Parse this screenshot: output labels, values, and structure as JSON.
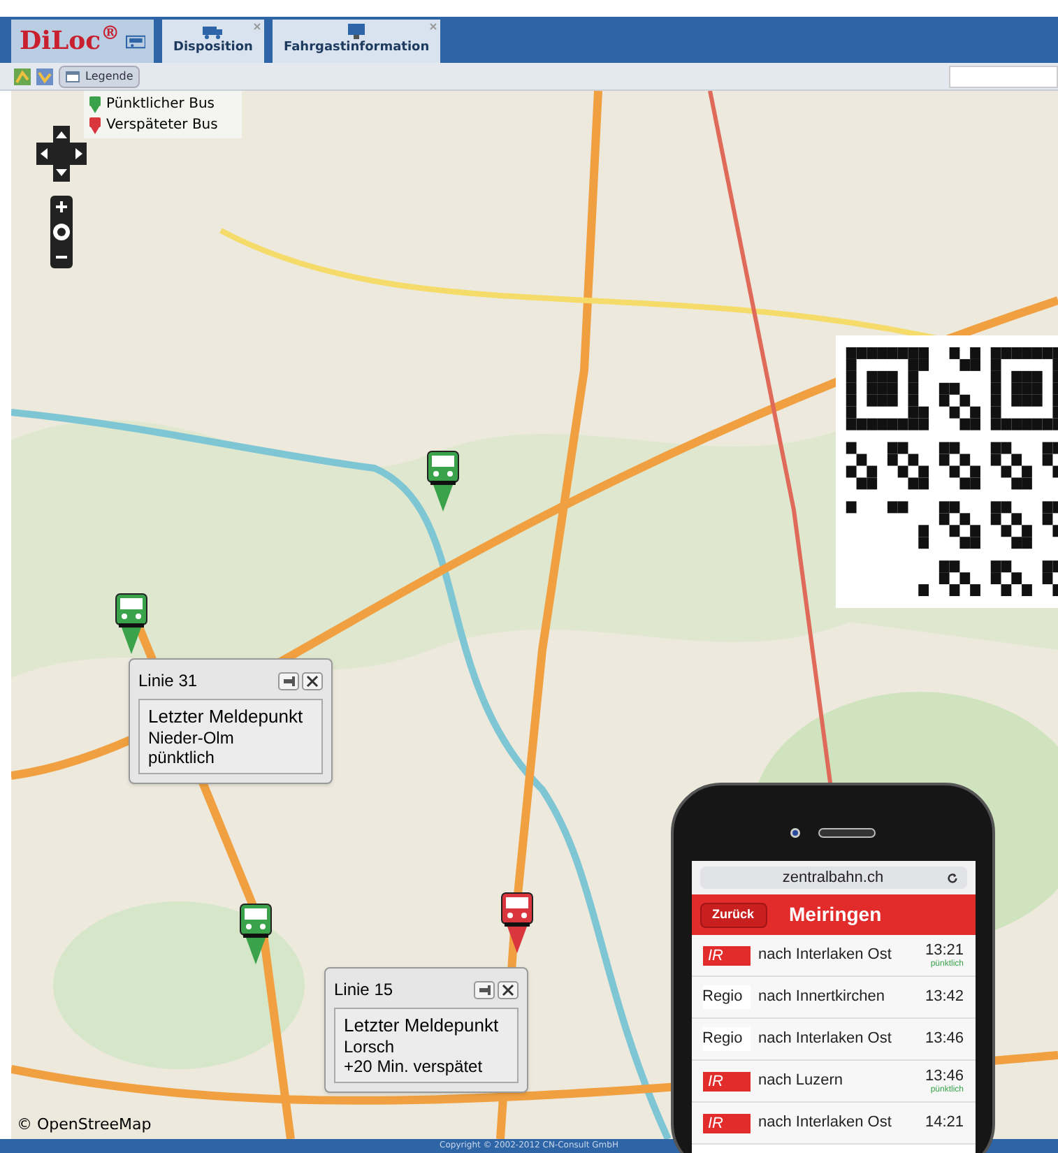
{
  "header": {
    "logo": "DiLoc$^{®}$",
    "tabs": [
      {
        "label": "Disposition",
        "kind": "dispatch"
      },
      {
        "label": "Fahrgastinformation",
        "kind": "info"
      }
    ]
  },
  "toolbar": {
    "legend_button": "Legende"
  },
  "legend": [
    {
      "label": "Pünktlicher Bus",
      "color": "#3aa24a"
    },
    {
      "label": "Verspäteter Bus",
      "color": "#d9363e"
    }
  ],
  "map": {
    "attribution": "© OpenStreeMap"
  },
  "buses": [
    {
      "color": "#3aa24a"
    },
    {
      "color": "#3aa24a"
    },
    {
      "color": "#3aa24a"
    },
    {
      "color": "#d9363e"
    }
  ],
  "popups": [
    {
      "title": "Linie 31",
      "heading": "Letzter Meldepunkt",
      "place": "Nieder-Olm",
      "status": "pünktlich"
    },
    {
      "title": "Linie 15",
      "heading": "Letzter Meldepunkt",
      "place": "Lorsch",
      "status": "+20 Min. verspätet"
    }
  ],
  "phone": {
    "url": "zentralbahn.ch",
    "back": "Zurück",
    "title": "Meiringen",
    "departures": [
      {
        "train": "IR",
        "kind": "ir",
        "destination": "nach Interlaken Ost",
        "time": "13:21",
        "note": "pünktlich"
      },
      {
        "train": "Regio",
        "kind": "regio",
        "destination": "nach Innertkirchen",
        "time": "13:42"
      },
      {
        "train": "Regio",
        "kind": "regio",
        "destination": "nach Interlaken Ost",
        "time": "13:46"
      },
      {
        "train": "IR",
        "kind": "ir",
        "destination": "nach Luzern",
        "time": "13:46",
        "note": "pünktlich"
      },
      {
        "train": "IR",
        "kind": "ir",
        "destination": "nach Interlaken Ost",
        "time": "14:21"
      }
    ]
  },
  "footer": {
    "copyright": "Copyright © 2002-2012 CN-Consult GmbH"
  }
}
